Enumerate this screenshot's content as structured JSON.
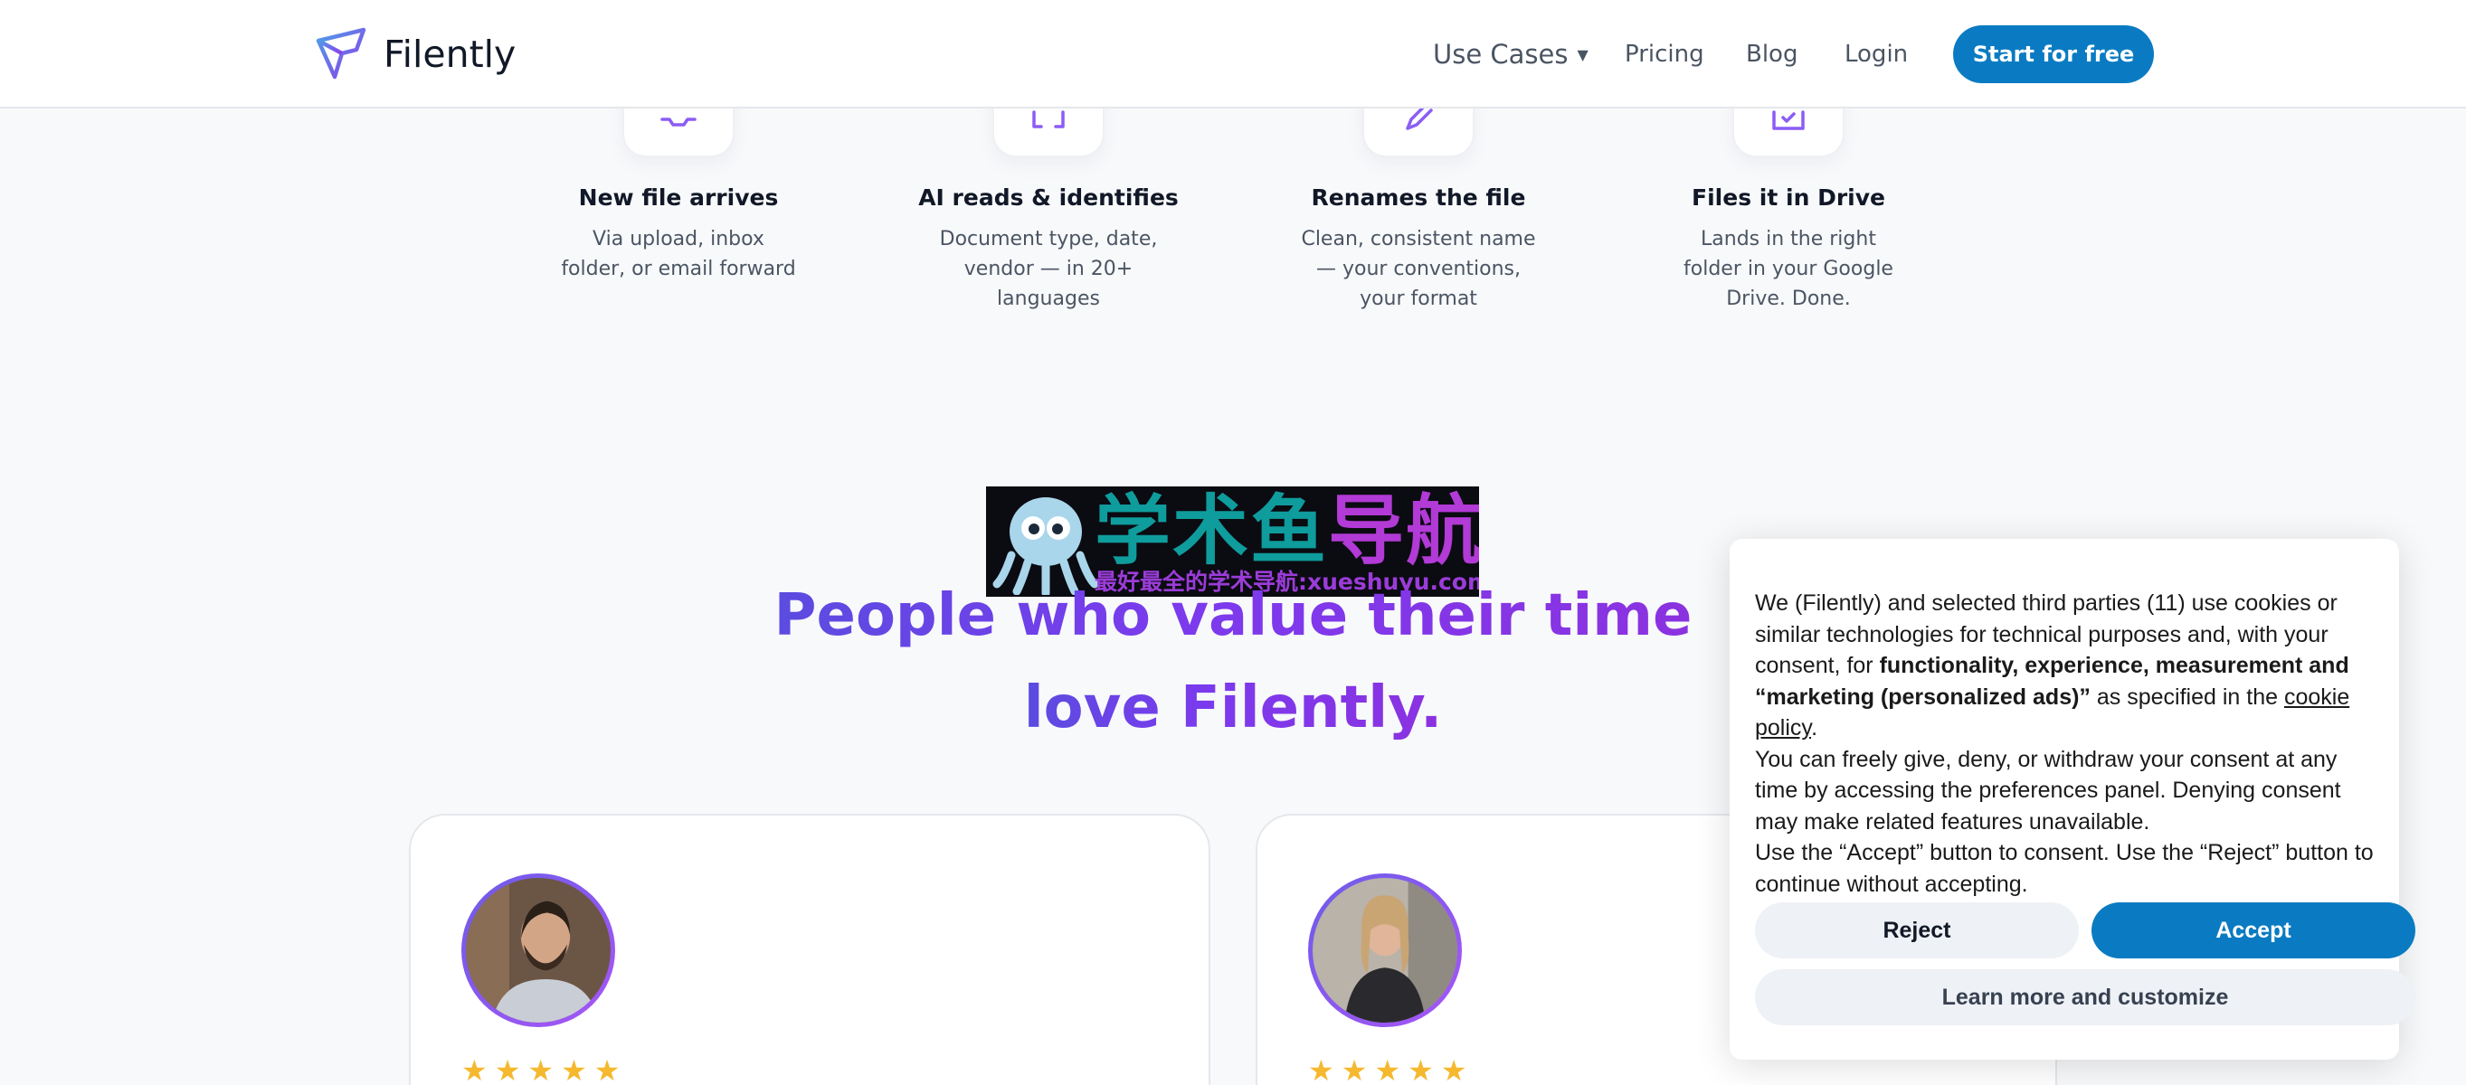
{
  "header": {
    "logo_text": "Filently",
    "nav": {
      "use_cases": "Use Cases",
      "pricing": "Pricing",
      "blog": "Blog",
      "login": "Login"
    },
    "cta_label": "Start for free"
  },
  "steps": [
    {
      "title": "New file arrives",
      "desc": "Via upload, inbox folder, or email forward",
      "icon": "inbox-icon"
    },
    {
      "title": "AI reads & identifies",
      "desc": "Document type, date, vendor — in 20+ languages",
      "icon": "scan-icon"
    },
    {
      "title": "Renames the file",
      "desc": "Clean, consistent name — your conventions, your format",
      "icon": "pencil-icon"
    },
    {
      "title": "Files it in Drive",
      "desc": "Lands in the right folder in your Google Drive. Done.",
      "icon": "folder-check-icon"
    }
  ],
  "banner": {
    "title_teal": "学术鱼",
    "title_purple": "导航",
    "subtitle": "最好最全的学术导航:xueshuyu.com"
  },
  "headline": {
    "line1": "People who value their time",
    "line2": "love Filently."
  },
  "testimonials": [
    {
      "rating": 5,
      "stars": "★"
    },
    {
      "rating": 5,
      "stars": "★"
    }
  ],
  "cookie": {
    "text_1": "We (Filently) and selected third parties (11) use cookies or similar technologies for technical purposes and, with your consent, for ",
    "text_bold": "functionality, experience, measurement and “marketing (personalized ads)”",
    "text_2": " as specified in the ",
    "policy_link": "cookie policy",
    "text_3": ".",
    "para_2": "You can freely give, deny, or withdraw your consent at any time by accessing the preferences panel. Denying consent may make related features unavailable.",
    "para_3": "Use the “Accept” button to consent. Use the “Reject” button to continue without accepting.",
    "reject_label": "Reject",
    "accept_label": "Accept",
    "learn_label": "Learn more and customize"
  },
  "colors": {
    "brand": "#0a7bc2",
    "headline_start": "#5b4ce0",
    "headline_end": "#8b32e0",
    "star": "#f5b82e"
  }
}
